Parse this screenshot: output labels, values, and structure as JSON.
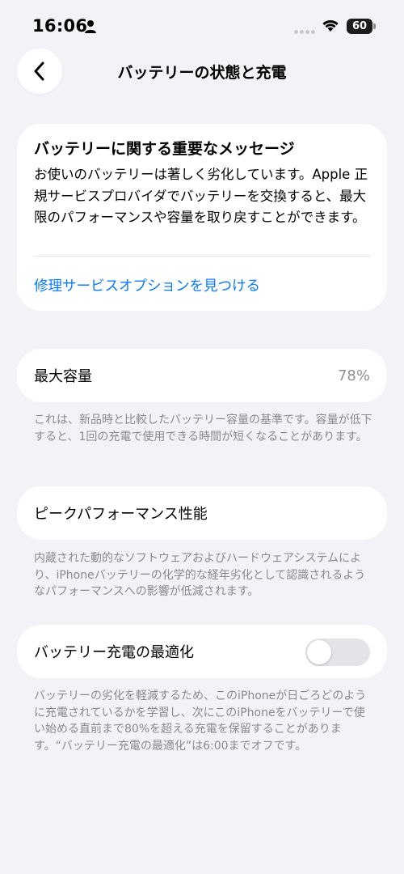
{
  "status_bar": {
    "time": "16:06",
    "battery_level": "60"
  },
  "nav": {
    "title": "バッテリーの状態と充電",
    "back_icon": "chevron-left-icon"
  },
  "message_card": {
    "title": "バッテリーに関する重要なメッセージ",
    "body": "お使いのバッテリーは著しく劣化しています。Apple 正規サービスプロバイダでバッテリーを交換すると、最大限のパフォーマンスや容量を取り戻すことができます。",
    "link": "修理サービスオプションを見つける"
  },
  "max_capacity": {
    "label": "最大容量",
    "value": "78%",
    "footnote": "これは、新品時と比較したバッテリー容量の基準です。容量が低下すると、1回の充電で使用できる時間が短くなることがあります。"
  },
  "peak_performance": {
    "label": "ピークパフォーマンス性能",
    "footnote": "内蔵された動的なソフトウェアおよびハードウェアシステムにより、iPhoneバッテリーの化学的な経年劣化として認識されるようなパフォーマンスへの影響が低減されます。"
  },
  "optimized_charging": {
    "label": "バッテリー充電の最適化",
    "enabled": false,
    "footnote": "バッテリーの劣化を軽減するため、このiPhoneが日ごろどのように充電されているかを学習し、次にこのiPhoneをバッテリーで使い始める直前まで80%を超える充電を保留することがあります。“バッテリー充電の最適化”は6:00までオフです。"
  },
  "colors": {
    "background": "#f2f2f7",
    "card": "#ffffff",
    "link": "#0a7aff",
    "secondary_text": "#8a8a8e",
    "toggle_off": "#e3e3e8"
  }
}
